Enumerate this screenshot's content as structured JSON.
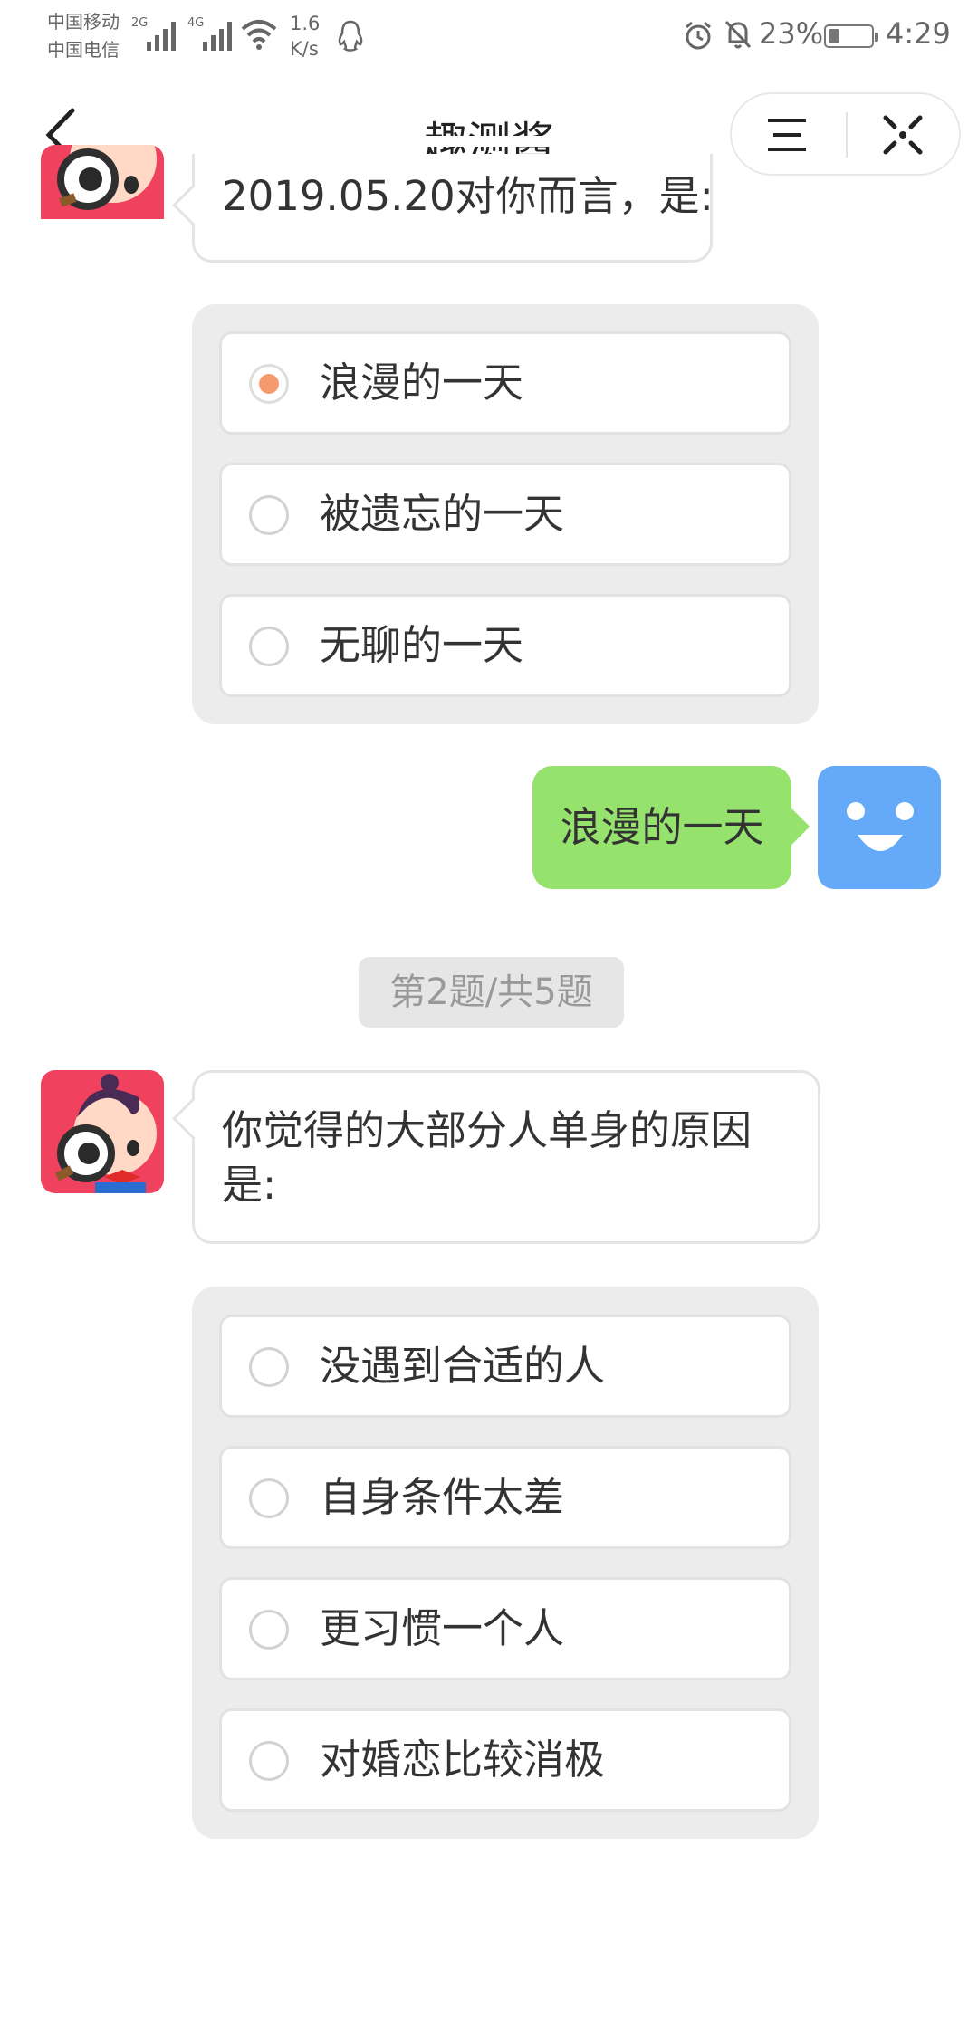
{
  "status_bar": {
    "carrier_1": "中国移动",
    "carrier_2": "中国电信",
    "net_1": "2G",
    "net_2": "4G",
    "speed_value": "1.6",
    "speed_unit": "K/s",
    "battery_percent": "23%",
    "time": "4:29"
  },
  "nav": {
    "title": "趣测酱"
  },
  "question_1": {
    "text": "2019.05.20对你而言，是:",
    "options": [
      "浪漫的一天",
      "被遗忘的一天",
      "无聊的一天"
    ],
    "selected_index": 0
  },
  "answer_1": {
    "text": "浪漫的一天"
  },
  "progress": {
    "text": "第2题/共5题"
  },
  "question_2": {
    "text_line_1": "你觉得的大部分人单身的原因",
    "text_line_2": "是:",
    "options": [
      "没遇到合适的人",
      "自身条件太差",
      "更习惯一个人",
      "对婚恋比较消极"
    ]
  },
  "colors": {
    "accent_green": "#95e36d",
    "radio_selected": "#f59a6e",
    "user_avatar": "#64aaf8"
  }
}
